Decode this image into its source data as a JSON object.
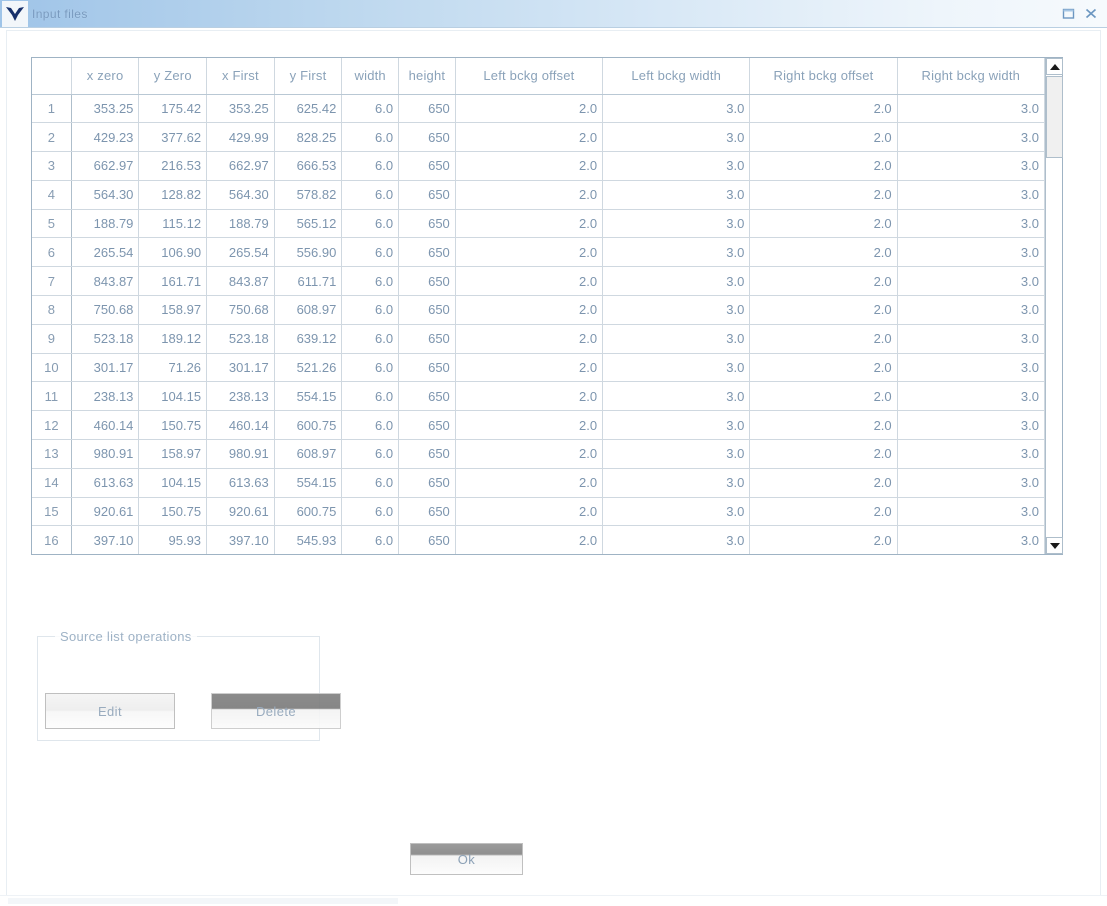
{
  "window": {
    "title": "Input files",
    "icon": "app-icon",
    "buttons": [
      {
        "name": "maximize",
        "label": "Maximize"
      },
      {
        "name": "close",
        "label": "Close"
      }
    ]
  },
  "table": {
    "columns": [
      "x zero",
      "y Zero",
      "x First",
      "y First",
      "width",
      "height",
      "Left bckg offset",
      "Left bckg width",
      "Right bckg offset",
      "Right bckg width"
    ],
    "rows": [
      {
        "n": "1",
        "x_zero": "353.25",
        "y_zero": "175.42",
        "x_first": "353.25",
        "y_first": "625.42",
        "width": "6.0",
        "height": "650",
        "lbo": "2.0",
        "lbw": "3.0",
        "rbo": "2.0",
        "rbw": "3.0"
      },
      {
        "n": "2",
        "x_zero": "429.23",
        "y_zero": "377.62",
        "x_first": "429.99",
        "y_first": "828.25",
        "width": "6.0",
        "height": "650",
        "lbo": "2.0",
        "lbw": "3.0",
        "rbo": "2.0",
        "rbw": "3.0"
      },
      {
        "n": "3",
        "x_zero": "662.97",
        "y_zero": "216.53",
        "x_first": "662.97",
        "y_first": "666.53",
        "width": "6.0",
        "height": "650",
        "lbo": "2.0",
        "lbw": "3.0",
        "rbo": "2.0",
        "rbw": "3.0"
      },
      {
        "n": "4",
        "x_zero": "564.30",
        "y_zero": "128.82",
        "x_first": "564.30",
        "y_first": "578.82",
        "width": "6.0",
        "height": "650",
        "lbo": "2.0",
        "lbw": "3.0",
        "rbo": "2.0",
        "rbw": "3.0"
      },
      {
        "n": "5",
        "x_zero": "188.79",
        "y_zero": "115.12",
        "x_first": "188.79",
        "y_first": "565.12",
        "width": "6.0",
        "height": "650",
        "lbo": "2.0",
        "lbw": "3.0",
        "rbo": "2.0",
        "rbw": "3.0"
      },
      {
        "n": "6",
        "x_zero": "265.54",
        "y_zero": "106.90",
        "x_first": "265.54",
        "y_first": "556.90",
        "width": "6.0",
        "height": "650",
        "lbo": "2.0",
        "lbw": "3.0",
        "rbo": "2.0",
        "rbw": "3.0"
      },
      {
        "n": "7",
        "x_zero": "843.87",
        "y_zero": "161.71",
        "x_first": "843.87",
        "y_first": "611.71",
        "width": "6.0",
        "height": "650",
        "lbo": "2.0",
        "lbw": "3.0",
        "rbo": "2.0",
        "rbw": "3.0"
      },
      {
        "n": "8",
        "x_zero": "750.68",
        "y_zero": "158.97",
        "x_first": "750.68",
        "y_first": "608.97",
        "width": "6.0",
        "height": "650",
        "lbo": "2.0",
        "lbw": "3.0",
        "rbo": "2.0",
        "rbw": "3.0"
      },
      {
        "n": "9",
        "x_zero": "523.18",
        "y_zero": "189.12",
        "x_first": "523.18",
        "y_first": "639.12",
        "width": "6.0",
        "height": "650",
        "lbo": "2.0",
        "lbw": "3.0",
        "rbo": "2.0",
        "rbw": "3.0"
      },
      {
        "n": "10",
        "x_zero": "301.17",
        "y_zero": "71.26",
        "x_first": "301.17",
        "y_first": "521.26",
        "width": "6.0",
        "height": "650",
        "lbo": "2.0",
        "lbw": "3.0",
        "rbo": "2.0",
        "rbw": "3.0"
      },
      {
        "n": "11",
        "x_zero": "238.13",
        "y_zero": "104.15",
        "x_first": "238.13",
        "y_first": "554.15",
        "width": "6.0",
        "height": "650",
        "lbo": "2.0",
        "lbw": "3.0",
        "rbo": "2.0",
        "rbw": "3.0"
      },
      {
        "n": "12",
        "x_zero": "460.14",
        "y_zero": "150.75",
        "x_first": "460.14",
        "y_first": "600.75",
        "width": "6.0",
        "height": "650",
        "lbo": "2.0",
        "lbw": "3.0",
        "rbo": "2.0",
        "rbw": "3.0"
      },
      {
        "n": "13",
        "x_zero": "980.91",
        "y_zero": "158.97",
        "x_first": "980.91",
        "y_first": "608.97",
        "width": "6.0",
        "height": "650",
        "lbo": "2.0",
        "lbw": "3.0",
        "rbo": "2.0",
        "rbw": "3.0"
      },
      {
        "n": "14",
        "x_zero": "613.63",
        "y_zero": "104.15",
        "x_first": "613.63",
        "y_first": "554.15",
        "width": "6.0",
        "height": "650",
        "lbo": "2.0",
        "lbw": "3.0",
        "rbo": "2.0",
        "rbw": "3.0"
      },
      {
        "n": "15",
        "x_zero": "920.61",
        "y_zero": "150.75",
        "x_first": "920.61",
        "y_first": "600.75",
        "width": "6.0",
        "height": "650",
        "lbo": "2.0",
        "lbw": "3.0",
        "rbo": "2.0",
        "rbw": "3.0"
      },
      {
        "n": "16",
        "x_zero": "397.10",
        "y_zero": "95.93",
        "x_first": "397.10",
        "y_first": "545.93",
        "width": "6.0",
        "height": "650",
        "lbo": "2.0",
        "lbw": "3.0",
        "rbo": "2.0",
        "rbw": "3.0"
      }
    ]
  },
  "source_list_operations": {
    "legend": "Source list operations",
    "edit_label": "Edit",
    "delete_label": "Delete"
  },
  "footer": {
    "ok_label": "Ok"
  },
  "colors": {
    "titlebar_start": "#9fc4e8",
    "titlebar_end": "#f6fafd",
    "text": "#6f8aa6",
    "grid_line": "#cfd8e0"
  }
}
